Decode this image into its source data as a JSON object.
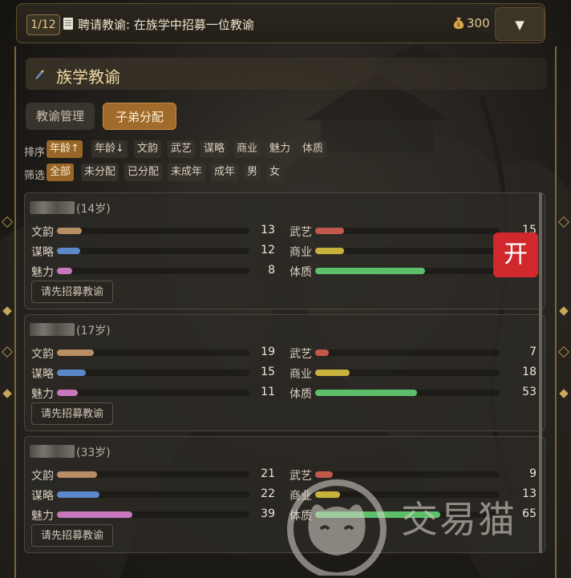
{
  "topbar": {
    "step": "1/12",
    "task": "聘请教谕: 在族学中招募一位教谕",
    "money": "300",
    "menu_icon": "▼"
  },
  "panel": {
    "title": "族学教谕"
  },
  "tabs": [
    {
      "label": "教谕管理",
      "active": false
    },
    {
      "label": "子弟分配",
      "active": true
    }
  ],
  "sort": {
    "label": "排序",
    "options": [
      "年龄↑",
      "年龄↓",
      "文韵",
      "武艺",
      "谋略",
      "商业",
      "魅力",
      "体质"
    ],
    "selected": "年龄↑"
  },
  "filter": {
    "label": "筛选",
    "options": [
      "全部",
      "未分配",
      "已分配",
      "未成年",
      "成年",
      "男",
      "女"
    ],
    "selected": "全部"
  },
  "stat_labels": {
    "wenyun": "文韵",
    "wuyi": "武艺",
    "moulue": "谋略",
    "shangye": "商业",
    "meili": "魅力",
    "tizhi": "体质"
  },
  "colors": {
    "wenyun": "#b98e66",
    "wuyi": "#c3584d",
    "moulue": "#5b88c9",
    "shangye": "#c9b23c",
    "meili": "#c877bd",
    "tizhi": "#5cc06a",
    "accent": "#a06a2a"
  },
  "members": [
    {
      "age": "(14岁)",
      "stats": {
        "wenyun": 13,
        "wuyi": 15,
        "moulue": 12,
        "shangye": 15,
        "meili": 8,
        "tizhi": 57
      },
      "button": "请先招募教谕"
    },
    {
      "age": "(17岁)",
      "stats": {
        "wenyun": 19,
        "wuyi": 7,
        "moulue": 15,
        "shangye": 18,
        "meili": 11,
        "tizhi": 53
      },
      "button": "请先招募教谕"
    },
    {
      "age": "(33岁)",
      "stats": {
        "wenyun": 21,
        "wuyi": 9,
        "moulue": 22,
        "shangye": 13,
        "meili": 39,
        "tizhi": 65
      },
      "button": "请先招募教谕"
    }
  ],
  "open_badge": "开",
  "watermark": "交易猫"
}
